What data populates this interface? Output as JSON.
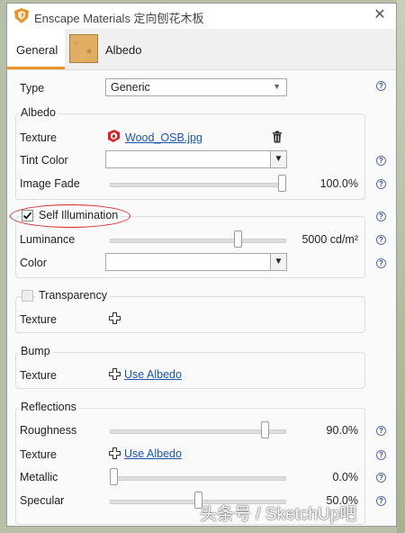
{
  "window": {
    "title": "Enscape Materials 定向刨花木板",
    "close_glyph": "✕"
  },
  "tabs": {
    "general": "General",
    "albedo": "Albedo"
  },
  "general": {
    "type_label": "Type",
    "type_value": "Generic"
  },
  "albedo": {
    "group_title": "Albedo",
    "texture_label": "Texture",
    "texture_file": "Wood_OSB.jpg",
    "tint_label": "Tint Color",
    "fade_label": "Image Fade",
    "fade_value": "100.0%",
    "fade_fraction": 1.0
  },
  "self_illumination": {
    "title": "Self Illumination",
    "checked": true,
    "luminance_label": "Luminance",
    "luminance_value": "5000 cd/m²",
    "luminance_fraction": 0.74,
    "color_label": "Color"
  },
  "transparency": {
    "title": "Transparency",
    "checked": false,
    "texture_label": "Texture"
  },
  "bump": {
    "title": "Bump",
    "texture_label": "Texture",
    "texture_link": "Use Albedo"
  },
  "reflections": {
    "title": "Reflections",
    "roughness_label": "Roughness",
    "roughness_value": "90.0%",
    "roughness_fraction": 0.9,
    "texture_label": "Texture",
    "texture_link": "Use Albedo",
    "metallic_label": "Metallic",
    "metallic_value": "0.0%",
    "metallic_fraction": 0.0,
    "specular_label": "Specular",
    "specular_value": "50.0%",
    "specular_fraction": 0.5
  },
  "help_glyph": "?",
  "watermark": "头条号 / SketchUp吧",
  "colors": {
    "accent": "#e8942a",
    "link": "#1a56b0",
    "highlight_oval": "#d9262c"
  }
}
